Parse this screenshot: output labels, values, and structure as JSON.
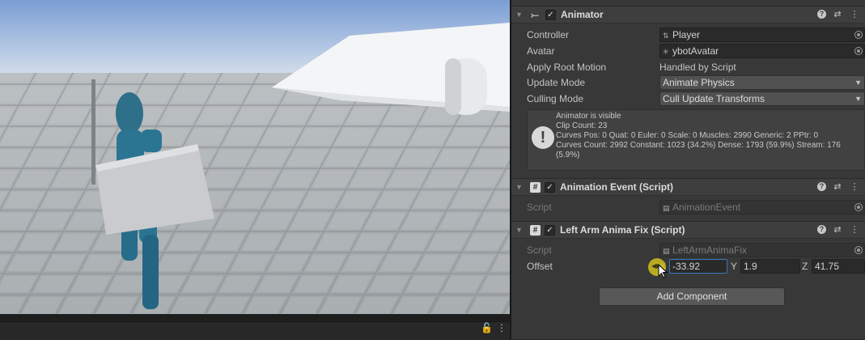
{
  "scene": {
    "bottom_icons": [
      "lock-icon",
      "kebab-menu-icon"
    ],
    "lock_glyph": "🔓",
    "menu_glyph": "⋮"
  },
  "inspector": {
    "animator": {
      "title": "Animator",
      "enabled": true,
      "fields": {
        "controller_label": "Controller",
        "controller_value": "Player",
        "avatar_label": "Avatar",
        "avatar_value": "ybotAvatar",
        "apply_root_motion_label": "Apply Root Motion",
        "apply_root_motion_value": "Handled by Script",
        "update_mode_label": "Update Mode",
        "update_mode_value": "Animate Physics",
        "culling_mode_label": "Culling Mode",
        "culling_mode_value": "Cull Update Transforms"
      },
      "info": {
        "line1": "Animator is visible",
        "line2": "Clip Count: 23",
        "line3": "Curves Pos: 0 Quat: 0 Euler: 0 Scale: 0 Muscles: 2990 Generic: 2 PPtr: 0",
        "line4": "Curves Count: 2992 Constant: 1023 (34.2%) Dense: 1793 (59.9%) Stream: 176",
        "line5": "(5.9%)"
      }
    },
    "animation_event": {
      "title": "Animation Event (Script)",
      "enabled": true,
      "script_label": "Script",
      "script_value": "AnimationEvent"
    },
    "left_arm_fix": {
      "title": "Left Arm Anima Fix (Script)",
      "enabled": true,
      "script_label": "Script",
      "script_value": "LeftArmAnimaFix",
      "offset_label": "Offset",
      "offset": {
        "x_label": "X",
        "x": "-33.92",
        "y_label": "Y",
        "y": "1.9",
        "z_label": "Z",
        "z": "41.75"
      }
    },
    "add_component_label": "Add Component",
    "header_glyphs": {
      "help": "?",
      "presets": "⇄",
      "menu": "⋮",
      "fold": "▼",
      "check": "✓"
    }
  },
  "colors": {
    "inspector_bg": "#383838",
    "header_bg": "#3e3e3e",
    "field_bg": "#2a2a2a",
    "focus_blue": "#3a79bb",
    "sky_top": "#7b9ed4",
    "drag_cursor": "#cec01e"
  }
}
